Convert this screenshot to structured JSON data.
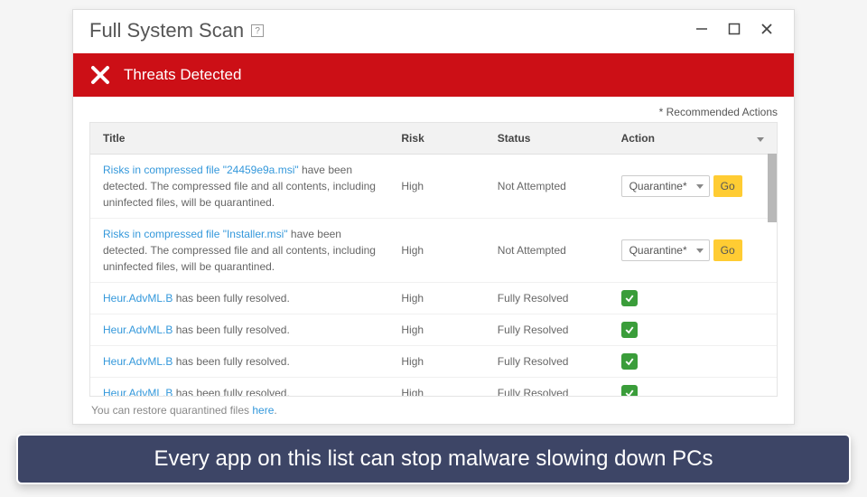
{
  "window": {
    "title": "Full System Scan",
    "help_glyph": "?"
  },
  "banner": {
    "text": "Threats Detected"
  },
  "recommended_label": "* Recommended Actions",
  "columns": {
    "title": "Title",
    "risk": "Risk",
    "status": "Status",
    "action": "Action"
  },
  "action_select_default": "Quarantine*",
  "go_label": "Go",
  "rows": [
    {
      "link": "Risks in compressed file \"24459e9a.msi\"",
      "desc": " have been detected. The compressed file and all contents, including uninfected files, will be quarantined.",
      "risk": "High",
      "status": "Not Attempted",
      "resolved": false
    },
    {
      "link": "Risks in compressed file \"Installer.msi\"",
      "desc": " have been detected. The compressed file and all contents, including uninfected files, will be quarantined.",
      "risk": "High",
      "status": "Not Attempted",
      "resolved": false
    },
    {
      "link": "Heur.AdvML.B",
      "desc": " has been fully resolved.",
      "risk": "High",
      "status": "Fully Resolved",
      "resolved": true
    },
    {
      "link": "Heur.AdvML.B",
      "desc": " has been fully resolved.",
      "risk": "High",
      "status": "Fully Resolved",
      "resolved": true
    },
    {
      "link": "Heur.AdvML.B",
      "desc": " has been fully resolved.",
      "risk": "High",
      "status": "Fully Resolved",
      "resolved": true
    },
    {
      "link": "Heur.AdvML.B",
      "desc": " has been fully resolved.",
      "risk": "High",
      "status": "Fully Resolved",
      "resolved": true
    }
  ],
  "footer": {
    "pre": "You can restore quarantined files ",
    "link": "here",
    "post": "."
  },
  "caption": "Every app on this list can stop malware slowing down PCs"
}
